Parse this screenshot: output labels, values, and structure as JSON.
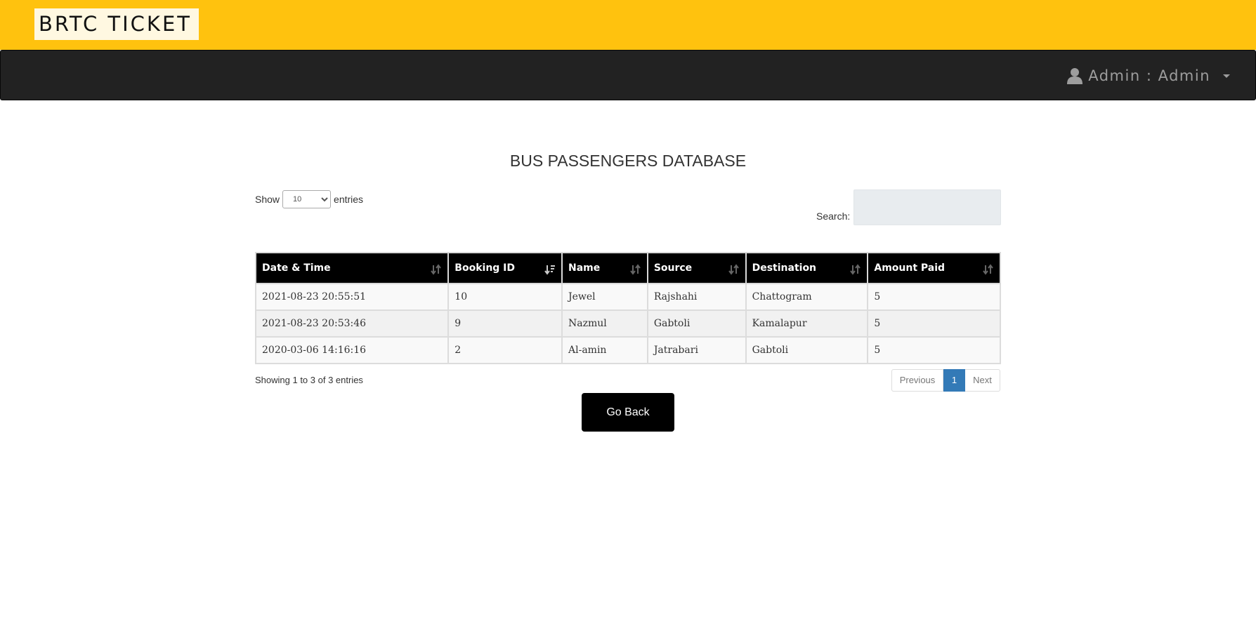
{
  "header": {
    "brand": "BRTC TICKET"
  },
  "navbar": {
    "user_label": "Admin : Admin",
    "user_icon": "user-icon",
    "caret_icon": "caret-down-icon"
  },
  "page": {
    "title": "BUS PASSENGERS DATABASE"
  },
  "length": {
    "show_label": "Show",
    "selected": "10",
    "entries_label": "entries"
  },
  "search": {
    "label": "Search:",
    "value": ""
  },
  "table": {
    "columns": [
      "Date & Time",
      "Booking ID",
      "Name",
      "Source",
      "Destination",
      "Amount Paid"
    ],
    "sorted_column": "Booking ID",
    "sort_direction": "desc",
    "rows": [
      [
        "2021-08-23 20:55:51",
        "10",
        "Jewel",
        "Rajshahi",
        "Chattogram",
        "5"
      ],
      [
        "2021-08-23 20:53:46",
        "9",
        "Nazmul",
        "Gabtoli",
        "Kamalapur",
        "5"
      ],
      [
        "2020-03-06 14:16:16",
        "2",
        "Al-amin",
        "Jatrabari",
        "Gabtoli",
        "5"
      ]
    ]
  },
  "info": "Showing 1 to 3 of 3 entries",
  "pagination": {
    "previous": "Previous",
    "current": "1",
    "next": "Next"
  },
  "actions": {
    "go_back": "Go Back"
  },
  "colors": {
    "header_bg": "#ffc20e",
    "navbar_bg": "#222222",
    "table_header_bg": "#000000",
    "pagination_active": "#337ab7"
  }
}
